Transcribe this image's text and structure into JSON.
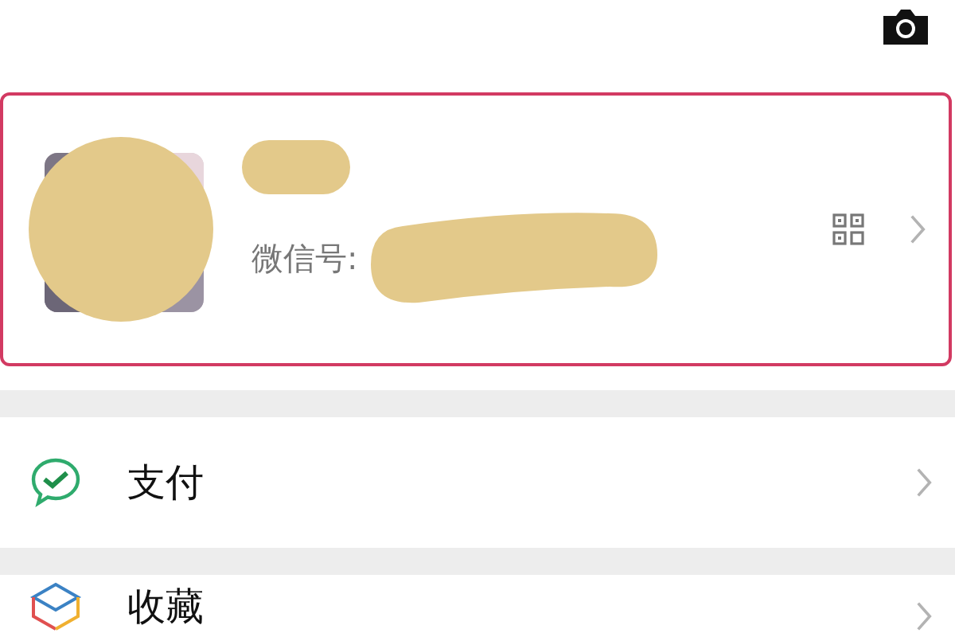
{
  "top_bar": {
    "camera": true
  },
  "profile": {
    "selected": true,
    "name_redacted": true,
    "id_label": "微信号:",
    "id_redacted": true
  },
  "menu_groups": [
    {
      "items": [
        {
          "kind": "pay",
          "label": "支付"
        }
      ]
    },
    {
      "items": [
        {
          "kind": "favorites",
          "label": "收藏"
        }
      ]
    }
  ]
}
